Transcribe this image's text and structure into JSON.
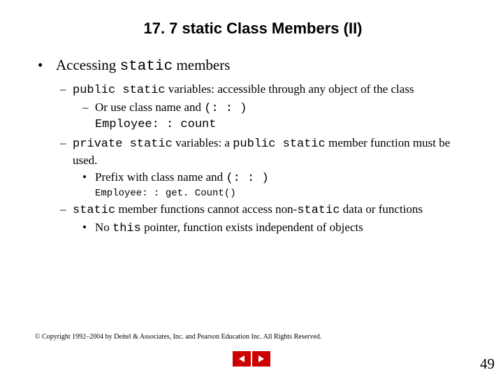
{
  "title": "17. 7  static Class Members (II)",
  "l1_pre": "Accessing ",
  "l1_mono": "static",
  "l1_post": " members",
  "l2a_mono": "public static",
  "l2a_post": " variables: accessible through any object of the class",
  "l3a_pre": "Or use class name and ",
  "l3a_mono": "(: : )",
  "l3a_code": "Employee: : count",
  "l2b_mono": "private static",
  "l2b_mid": " variables: a ",
  "l2b_mono2": "public static",
  "l2b_post": " member function must be used.",
  "l3b_pre": "Prefix with class name and ",
  "l3b_mono": "(: : )",
  "l3b_code": "Employee: : get. Count()",
  "l2c_mono": "static",
  "l2c_mid": " member functions cannot access non-",
  "l2c_mono2": "static",
  "l2c_post": " data or functions",
  "l3c_pre": "No ",
  "l3c_mono": "this",
  "l3c_post": " pointer, function exists independent of objects",
  "copyright": "© Copyright 1992–2004 by Deitel & Associates, Inc. and Pearson Education Inc. All Rights Reserved.",
  "pagenum": "49"
}
